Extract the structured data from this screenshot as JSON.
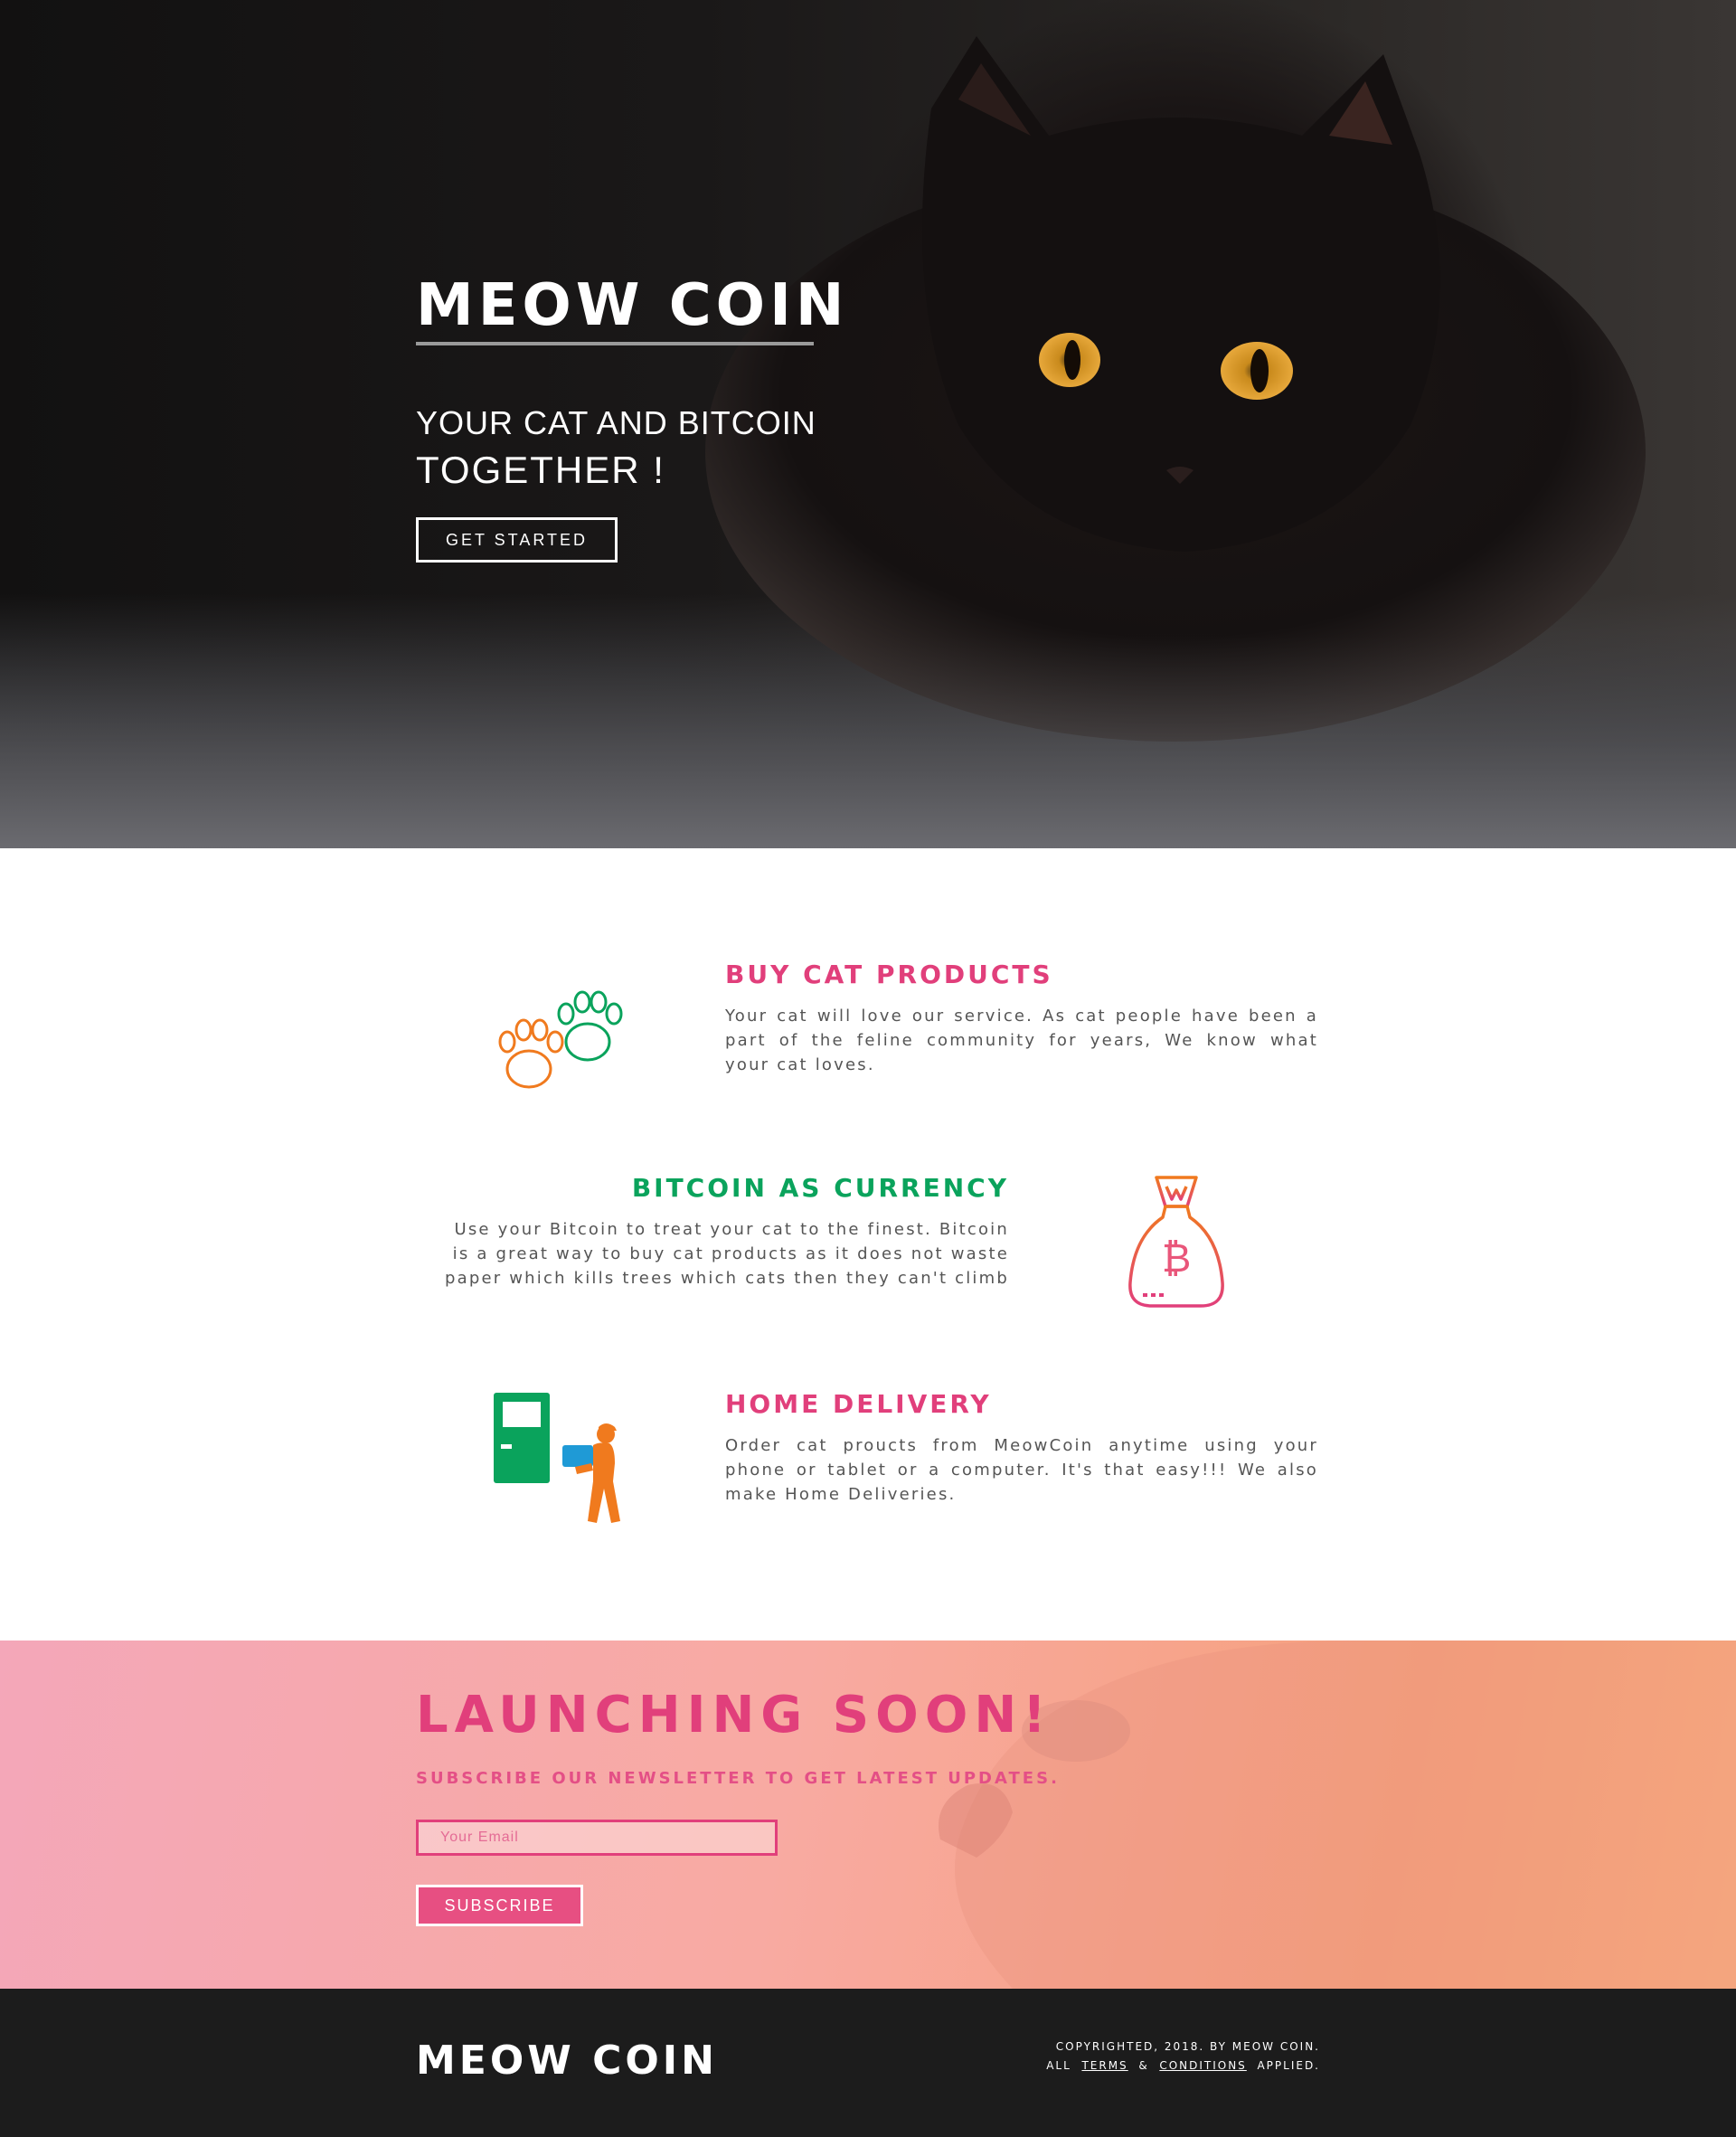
{
  "hero": {
    "title": "MEOW COIN",
    "subtitle_line1": "YOUR CAT AND BITCOIN",
    "subtitle_line2": "TOGETHER !",
    "cta_label": "GET STARTED",
    "image": "black-cat-photo"
  },
  "features": [
    {
      "title": "BUY CAT PRODUCTS",
      "text": "Your cat will love our service. As cat people have been a part of the feline community for years, We know what your cat loves.",
      "icon": "paw-prints-icon"
    },
    {
      "title": "BITCOIN AS CURRENCY",
      "text": "Use your Bitcoin to treat your cat to the finest. Bitcoin is a great way to buy cat products as it does not waste paper which kills trees which cats then they can't climb",
      "icon": "bitcoin-bag-icon"
    },
    {
      "title": "HOME DELIVERY",
      "text": "Order cat proucts from MeowCoin anytime using your phone or tablet or a computer. It's that easy!!! We also make Home Deliveries.",
      "icon": "delivery-person-icon"
    }
  ],
  "newsletter": {
    "title": "LAUNCHING SOON!",
    "subtitle": "SUBSCRIBE OUR NEWSLETTER TO GET LATEST UPDATES.",
    "email_placeholder": "Your Email",
    "button_label": "SUBSCRIBE"
  },
  "footer": {
    "logo": "MEOW COIN",
    "copyright": "COPYRIGHTED, 2018. BY MEOW COIN.",
    "all_prefix": "ALL",
    "terms_link": "TERMS",
    "amp": "&",
    "conditions_link": "CONDITIONS",
    "applied_suffix": "APPLIED."
  },
  "colors": {
    "accent_pink": "#e13f7b",
    "accent_green": "#0aa35c",
    "accent_orange": "#f07a1e",
    "footer_bg": "#1c1c1c"
  }
}
